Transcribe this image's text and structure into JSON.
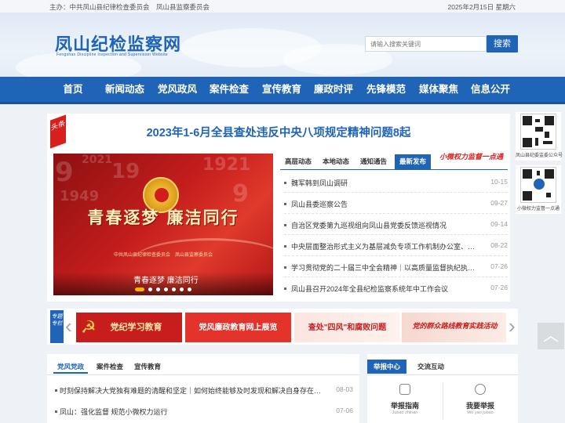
{
  "topbar": {
    "host": "主办：中共凤山县纪律检查委员会　凤山县监察委员会",
    "date": "2025年2月15日 星期六"
  },
  "header": {
    "site_title": "凤山纪检监察网",
    "site_subtitle": "Fengshan  Discipline Inspection and Supervision Website",
    "search_placeholder": "请输入搜索关键词",
    "search_button": "搜索"
  },
  "nav": {
    "items": [
      "首页",
      "新闻动态",
      "党风政风",
      "案件检查",
      "宣传教育",
      "廉政时评",
      "先锋模范",
      "媒体聚焦",
      "信息公开"
    ]
  },
  "headline": {
    "tag": "头条",
    "title": "2023年1-6月全县查处违反中央八项规定精神问题8起"
  },
  "slideshow": {
    "calligraphy": "青春逐梦 廉洁同行",
    "org_text": "中共凤山县纪律检查委员会　凤山县监察委员会",
    "caption": "青春逐梦 廉洁同行",
    "slide_count": 7,
    "active_index": 0
  },
  "news_tabs": {
    "tabs": [
      "高层动态",
      "本地动态",
      "通知通告",
      "最新发布"
    ],
    "active": "最新发布",
    "banner_text": "小微权力监督一点通"
  },
  "news": [
    {
      "title": "魏军韩到凤山调研",
      "date": "10-15"
    },
    {
      "title": "凤山县委巡察公告",
      "date": "09-27"
    },
    {
      "title": "自治区党委第九巡视组向凤山县党委反馈巡视情况",
      "date": "09-14"
    },
    {
      "title": "中央层面整治形式主义为基层减负专项工作机制办公室、…",
      "date": "08-22"
    },
    {
      "title": "学习贯彻党的二十届三中全会精神｜以高质量监督执纪执…",
      "date": "07-26"
    },
    {
      "title": "凤山县召开2024年全县纪检监察系统年中工作会议",
      "date": "07-26"
    }
  ],
  "qr_codes": [
    {
      "label": "凤山县纪委监委公众号"
    },
    {
      "label": "小微权力监督一点通"
    }
  ],
  "special_topics": {
    "label": "专题专栏",
    "banners": [
      {
        "title": "党纪学习教育",
        "bg": "#c81d1d",
        "fg": "#ffe9a6"
      },
      {
        "title": "党风廉政教育网上展览",
        "bg": "#e3332a",
        "fg": "#ffffff"
      },
      {
        "title": "查处\"四风\"和腐败问题",
        "bg": "#fbe5e0",
        "fg": "#c81d1d"
      },
      {
        "title": "党的群众路线教育实践活动",
        "bg": "#f6d8cf",
        "fg": "#c81d1d"
      }
    ]
  },
  "bottom_left": {
    "tabs": [
      "党风党政",
      "案件检查",
      "宣传教育"
    ],
    "active": "党风党政",
    "items": [
      {
        "title": "时刻保持解决大党独有难题的清醒和坚定｜如何始终能够及时发现和解决自身存在的…",
        "date": "08-03"
      },
      {
        "title": "凤山：强化监督 规范小微权力运行",
        "date": "07-06"
      }
    ]
  },
  "bottom_right": {
    "tabs": [
      "举报中心",
      "交流互动"
    ],
    "services": [
      {
        "title": "举报指南",
        "subtitle": "Jubao zhinan"
      },
      {
        "title": "我要举报",
        "subtitle": "Wo yao jubao"
      }
    ]
  },
  "colors": {
    "brand_blue": "#1f64b6",
    "accent_red": "#d7201e"
  }
}
